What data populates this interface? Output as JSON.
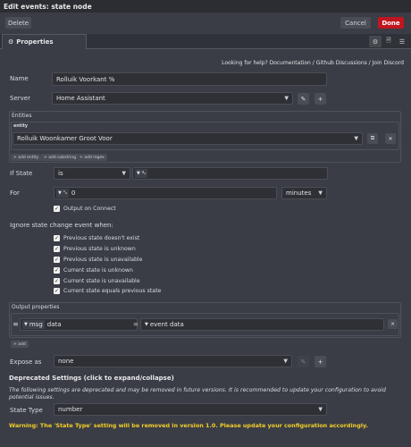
{
  "window": {
    "title": "Edit events: state node"
  },
  "toolbar": {
    "delete_label": "Delete",
    "cancel_label": "Cancel",
    "done_label": "Done"
  },
  "tabs": [
    {
      "label": "Properties",
      "icon": "gear-icon"
    }
  ],
  "tab_icons": [
    "gear-icon",
    "document-icon",
    "layers-icon"
  ],
  "help": {
    "prefix": "Looking for help?",
    "documentation": "Documentation",
    "sep1": "/",
    "discussions": "Github Discussions",
    "sep2": "/",
    "discord": "Join Discord"
  },
  "form": {
    "name": {
      "label": "Name",
      "value": "Rolluik Voorkant %"
    },
    "server": {
      "label": "Server",
      "value": "Home Assistant"
    },
    "entities": {
      "title": "Entities",
      "subtitle": "entity",
      "value": "Rolluik Woonkamer Groot Voor",
      "add_entity": "+ add entity",
      "add_substring": "+ add substring",
      "add_regex": "+ add regex"
    },
    "if_state": {
      "label": "If State",
      "operator": "is",
      "type_glyph": "ª₂",
      "value": ""
    },
    "for": {
      "label": "For",
      "type_glyph": "⁰₉",
      "value": "0",
      "unit": "minutes"
    },
    "output_on_connect": {
      "label": "Output on Connect",
      "checked": true
    },
    "ignore": {
      "title": "Ignore state change event when:",
      "items": [
        {
          "label": "Previous state doesn't exist",
          "checked": true
        },
        {
          "label": "Previous state is unknown",
          "checked": true
        },
        {
          "label": "Previous state is unavailable",
          "checked": true
        },
        {
          "label": "Current state is unknown",
          "checked": true
        },
        {
          "label": "Current state is unavailable",
          "checked": true
        },
        {
          "label": "Current state equals previous state",
          "checked": true
        }
      ]
    },
    "output_properties": {
      "title": "Output properties",
      "row": {
        "type": "msg",
        "property": "data",
        "equals": "=",
        "value_type": "event data"
      },
      "add_label": "+ add"
    },
    "expose_as": {
      "label": "Expose as",
      "value": "none"
    },
    "deprecated": {
      "title": "Deprecated Settings (click to expand/collapse)",
      "description": "The following settings are deprecated and may be removed in future versions. It is recommended to update your configuration to avoid potential issues.",
      "state_type": {
        "label": "State Type",
        "value": "number"
      },
      "warning": "Warning: The 'State Type' setting will be removed in version 1.0. Please update your configuration accordingly."
    }
  },
  "colors": {
    "accent": "#c0161f",
    "background": "#3a3d45",
    "warning": "#f3ce2a"
  }
}
